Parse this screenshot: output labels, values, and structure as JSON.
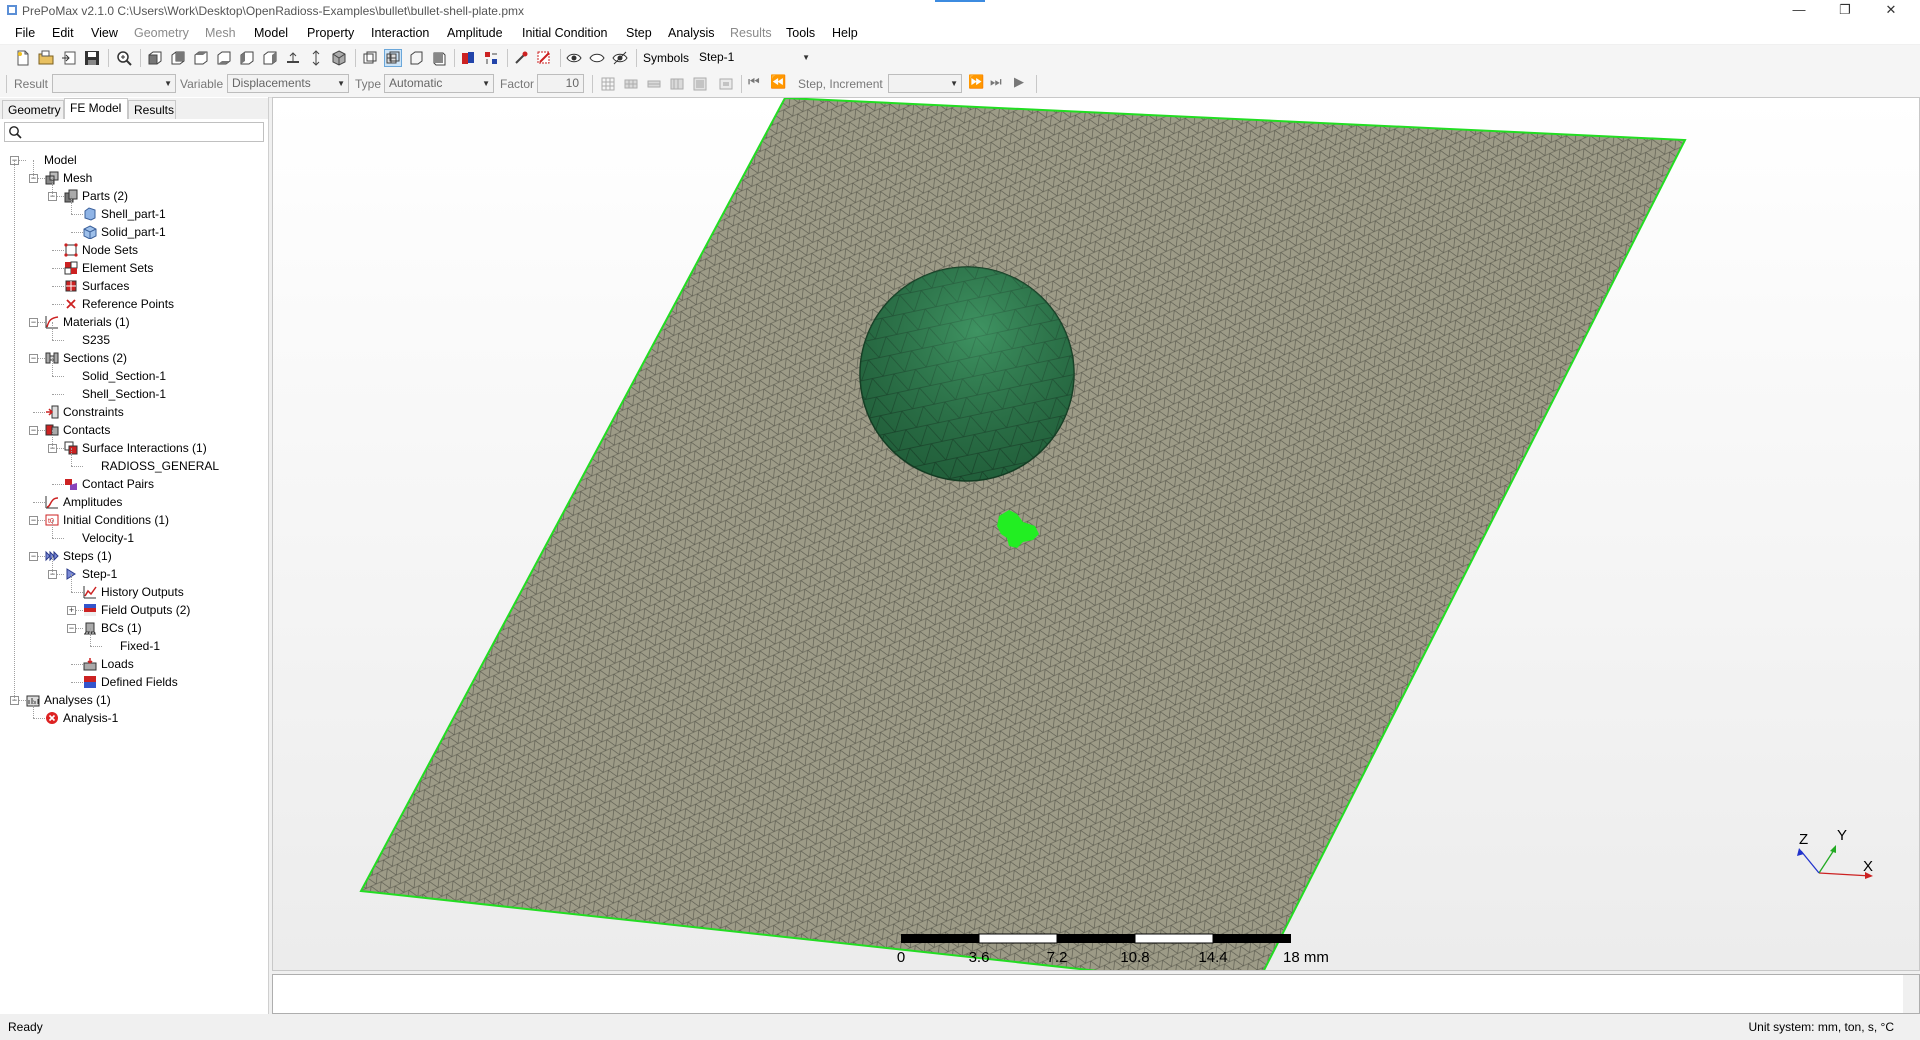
{
  "window": {
    "title": "PrePoMax v2.1.0   C:\\Users\\Work\\Desktop\\OpenRadioss-Examples\\bullet\\bullet-shell-plate.pmx",
    "minimize": "—",
    "restore": "❐",
    "close": "✕"
  },
  "menu": [
    {
      "label": "File"
    },
    {
      "label": "Edit"
    },
    {
      "label": "View"
    },
    {
      "label": "Geometry",
      "disabled": true
    },
    {
      "label": "Mesh",
      "disabled": true
    },
    {
      "label": "Model"
    },
    {
      "label": "Property"
    },
    {
      "label": "Interaction"
    },
    {
      "label": "Amplitude"
    },
    {
      "label": "Initial Condition"
    },
    {
      "label": "Step"
    },
    {
      "label": "Analysis"
    },
    {
      "label": "Results",
      "disabled": true
    },
    {
      "label": "Tools"
    },
    {
      "label": "Help"
    }
  ],
  "toolbar": {
    "symbols_label": "Symbols",
    "symbols_value": "Step-1",
    "result_label": "Result",
    "result_value": "",
    "variable_label": "Variable",
    "variable_value": "Displacements",
    "type_label": "Type",
    "type_value": "Automatic",
    "factor_label": "Factor",
    "factor_value": "10",
    "step_increment_label": "Step, Increment",
    "step_increment_value": ""
  },
  "tabs": [
    {
      "label": "Geometry",
      "active": false
    },
    {
      "label": "FE Model",
      "active": true
    },
    {
      "label": "Results",
      "active": false
    }
  ],
  "search": {
    "placeholder": ""
  },
  "tree": [
    {
      "label": "Model",
      "level": 0,
      "icon": "none",
      "expander": "-"
    },
    {
      "label": "Mesh",
      "level": 1,
      "icon": "mesh-icon",
      "expander": "-"
    },
    {
      "label": "Parts (2)",
      "level": 2,
      "icon": "parts-icon",
      "expander": "-"
    },
    {
      "label": "Shell_part-1",
      "level": 3,
      "icon": "shell-part-icon"
    },
    {
      "label": "Solid_part-1",
      "level": 3,
      "icon": "solid-part-icon"
    },
    {
      "label": "Node Sets",
      "level": 2,
      "icon": "node-sets-icon"
    },
    {
      "label": "Element Sets",
      "level": 2,
      "icon": "element-sets-icon"
    },
    {
      "label": "Surfaces",
      "level": 2,
      "icon": "surfaces-icon"
    },
    {
      "label": "Reference Points",
      "level": 2,
      "icon": "reference-point-icon"
    },
    {
      "label": "Materials (1)",
      "level": 1,
      "icon": "materials-icon",
      "expander": "-"
    },
    {
      "label": "S235",
      "level": 2,
      "icon": "none"
    },
    {
      "label": "Sections (2)",
      "level": 1,
      "icon": "sections-icon",
      "expander": "-"
    },
    {
      "label": "Solid_Section-1",
      "level": 2,
      "icon": "none"
    },
    {
      "label": "Shell_Section-1",
      "level": 2,
      "icon": "none"
    },
    {
      "label": "Constraints",
      "level": 1,
      "icon": "constraints-icon"
    },
    {
      "label": "Contacts",
      "level": 1,
      "icon": "contacts-icon",
      "expander": "-"
    },
    {
      "label": "Surface Interactions (1)",
      "level": 2,
      "icon": "surface-interactions-icon",
      "expander": "-"
    },
    {
      "label": "RADIOSS_GENERAL",
      "level": 3,
      "icon": "none"
    },
    {
      "label": "Contact Pairs",
      "level": 2,
      "icon": "contact-pairs-icon"
    },
    {
      "label": "Amplitudes",
      "level": 1,
      "icon": "amplitudes-icon"
    },
    {
      "label": "Initial Conditions (1)",
      "level": 1,
      "icon": "initial-conditions-icon",
      "expander": "-"
    },
    {
      "label": "Velocity-1",
      "level": 2,
      "icon": "none"
    },
    {
      "label": "Steps (1)",
      "level": 1,
      "icon": "steps-icon",
      "expander": "-"
    },
    {
      "label": "Step-1",
      "level": 2,
      "icon": "step-icon",
      "expander": "-"
    },
    {
      "label": "History Outputs",
      "level": 3,
      "icon": "history-outputs-icon"
    },
    {
      "label": "Field Outputs (2)",
      "level": 3,
      "icon": "field-outputs-icon",
      "expander": "+"
    },
    {
      "label": "BCs (1)",
      "level": 3,
      "icon": "bcs-icon",
      "expander": "-"
    },
    {
      "label": "Fixed-1",
      "level": 4,
      "icon": "none"
    },
    {
      "label": "Loads",
      "level": 3,
      "icon": "loads-icon"
    },
    {
      "label": "Defined Fields",
      "level": 3,
      "icon": "defined-fields-icon"
    },
    {
      "label": "Analyses (1)",
      "level": 0,
      "icon": "analyses-icon",
      "expander": "-"
    },
    {
      "label": "Analysis-1",
      "level": 1,
      "icon": "analysis-error-icon"
    }
  ],
  "scale_bar": {
    "ticks": [
      "0",
      "3.6",
      "7.2",
      "10.8",
      "14.4"
    ],
    "end_label": "18 mm"
  },
  "triad": {
    "x": "X",
    "y": "Y",
    "z": "Z"
  },
  "status": {
    "left": "Ready",
    "right": "Unit system: mm, ton, s, °C"
  },
  "colors": {
    "plate": "#9c9a86",
    "plate_edge": "#22dd22",
    "sphere": "#2f7a4c",
    "highlight": "#22ee22",
    "accent": "#3c8be0"
  }
}
